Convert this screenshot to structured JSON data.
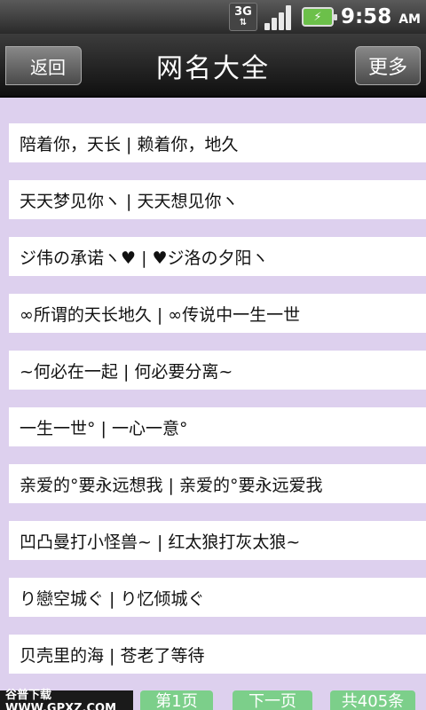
{
  "status_bar": {
    "network": "3G",
    "time": "9:58",
    "ampm": "AM"
  },
  "header": {
    "back_label": "返回",
    "title": "网名大全",
    "more_label": "更多"
  },
  "items": [
    "陪着你，天长 | 赖着你，地久",
    "天天梦见你ヽ | 天天想见你ヽ",
    "ジ伟の承诺ヽ♥ | ♥ジ洛の夕阳ヽ",
    "∞所谓的天长地久 | ∞传说中一生一世",
    "~何必在一起 | 何必要分离~",
    "一生一世° | 一心一意°",
    "亲爱的°要永远想我 | 亲爱的°要永远爱我",
    "凹凸曼打小怪兽~ | 红太狼打灰太狼~",
    "り戀空城ぐ | り忆倾城ぐ",
    "贝壳里的海 | 苍老了等待"
  ],
  "footer": {
    "watermark": "谷普下载 WWW.GPXZ.COM",
    "page_current": "第1页",
    "next_page": "下一页",
    "total": "共405条"
  }
}
